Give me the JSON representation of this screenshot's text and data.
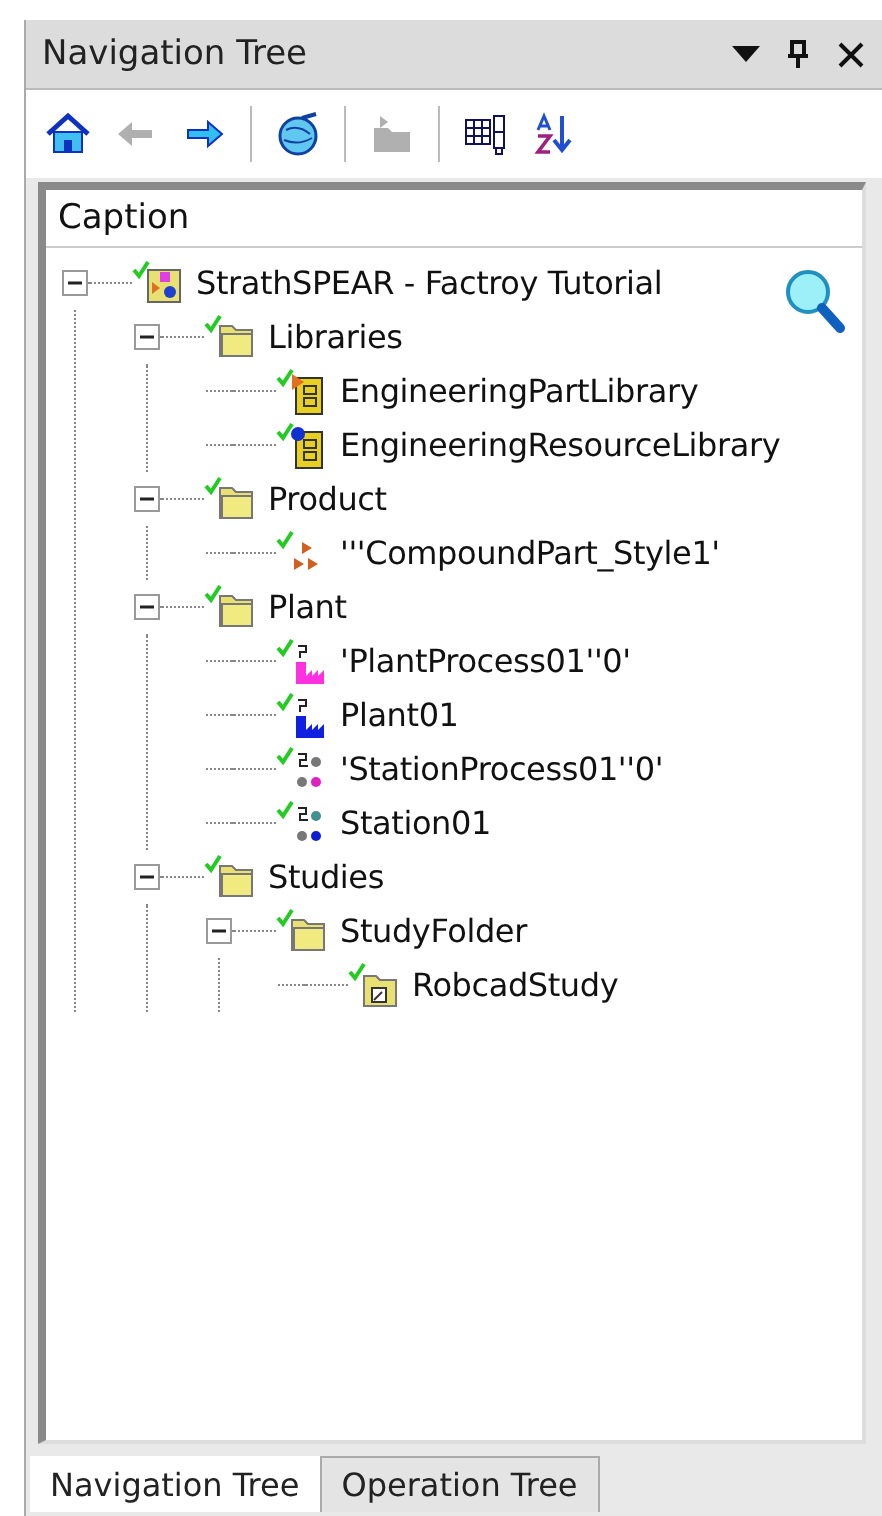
{
  "window": {
    "title": "Navigation Tree"
  },
  "toolbar_groups": [
    {
      "buttons": [
        {
          "kind": "home",
          "disabled": false
        },
        {
          "kind": "back",
          "disabled": true
        },
        {
          "kind": "forward",
          "disabled": false
        }
      ]
    },
    {
      "buttons": [
        {
          "kind": "globe",
          "disabled": false
        }
      ]
    },
    {
      "buttons": [
        {
          "kind": "folder",
          "disabled": true
        }
      ]
    },
    {
      "buttons": [
        {
          "kind": "columns",
          "disabled": false
        },
        {
          "kind": "sort",
          "disabled": false
        }
      ]
    }
  ],
  "tree": {
    "column": "Caption",
    "nodes": [
      {
        "label": "StrathSPEAR - Factroy Tutorial",
        "kind": "project",
        "expanded": true,
        "children": [
          {
            "label": "Libraries",
            "kind": "folder",
            "expanded": true,
            "children": [
              {
                "label": "EngineeringPartLibrary",
                "kind": "part-library"
              },
              {
                "label": "EngineeringResourceLibrary",
                "kind": "resource-library"
              }
            ]
          },
          {
            "label": "Product",
            "kind": "folder",
            "expanded": true,
            "children": [
              {
                "label": "'''CompoundPart_Style1'",
                "kind": "compound-part"
              }
            ]
          },
          {
            "label": "Plant",
            "kind": "folder",
            "expanded": true,
            "children": [
              {
                "label": "'PlantProcess01''0'",
                "kind": "plant-process"
              },
              {
                "label": "Plant01",
                "kind": "plant"
              },
              {
                "label": "'StationProcess01''0'",
                "kind": "station-process"
              },
              {
                "label": "Station01",
                "kind": "station"
              }
            ]
          },
          {
            "label": "Studies",
            "kind": "folder",
            "expanded": true,
            "children": [
              {
                "label": "StudyFolder",
                "kind": "folder",
                "expanded": true,
                "children": [
                  {
                    "label": "RobcadStudy",
                    "kind": "study"
                  }
                ]
              }
            ]
          }
        ]
      }
    ]
  },
  "tabs": [
    {
      "label": "Navigation Tree",
      "selected": true
    },
    {
      "label": "Operation Tree",
      "selected": false
    }
  ]
}
